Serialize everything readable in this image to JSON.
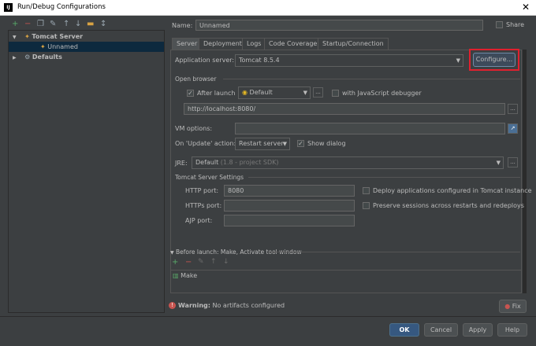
{
  "window": {
    "title": "Run/Debug Configurations",
    "app_icon": "IJ",
    "close_glyph": "✕"
  },
  "tree": {
    "items": [
      {
        "label": "Tomcat Server",
        "expander": "▼"
      },
      {
        "label": "Unnamed"
      },
      {
        "label": "Defaults",
        "expander": "▶"
      }
    ]
  },
  "header": {
    "name_label": "Name:",
    "name_value": "Unnamed",
    "share_label": "Share"
  },
  "tabs": [
    "Server",
    "Deployment",
    "Logs",
    "Code Coverage",
    "Startup/Connection"
  ],
  "server": {
    "app_server_label": "Application server:",
    "app_server_value": "Tomcat 8.5.4",
    "configure_label": "Configure...",
    "open_browser_title": "Open browser",
    "after_launch_label": "After launch",
    "browser_value": "Default",
    "more_button": "...",
    "js_debugger_label": "with JavaScript debugger",
    "url_value": "http://localhost:8080/",
    "vm_options_label": "VM options:",
    "on_update_label": "On 'Update' action:",
    "on_update_value": "Restart server",
    "show_dialog_label": "Show dialog",
    "jre_label": "JRE:",
    "jre_value": "Default",
    "jre_hint": "(1.8 - project SDK)",
    "tomcat_settings_title": "Tomcat Server Settings",
    "http_port_label": "HTTP port:",
    "http_port_value": "8080",
    "https_port_label": "HTTPs port:",
    "https_port_value": "",
    "ajp_port_label": "AJP port:",
    "ajp_port_value": "",
    "deploy_label": "Deploy applications configured in Tomcat instance",
    "preserve_label": "Preserve sessions across restarts and redeploys"
  },
  "before_launch": {
    "title": "Before launch: Make, Activate tool window",
    "items": [
      "Make"
    ]
  },
  "footer": {
    "warning_prefix": "Warning:",
    "warning_text": "No artifacts configured",
    "fix_label": "Fix",
    "ok_label": "OK",
    "cancel_label": "Cancel",
    "apply_label": "Apply",
    "help_label": "Help"
  },
  "colors": {
    "background": "#3c3f41",
    "highlight_border": "#e0202e",
    "default_button": "#365880",
    "selection": "#0d293e"
  }
}
